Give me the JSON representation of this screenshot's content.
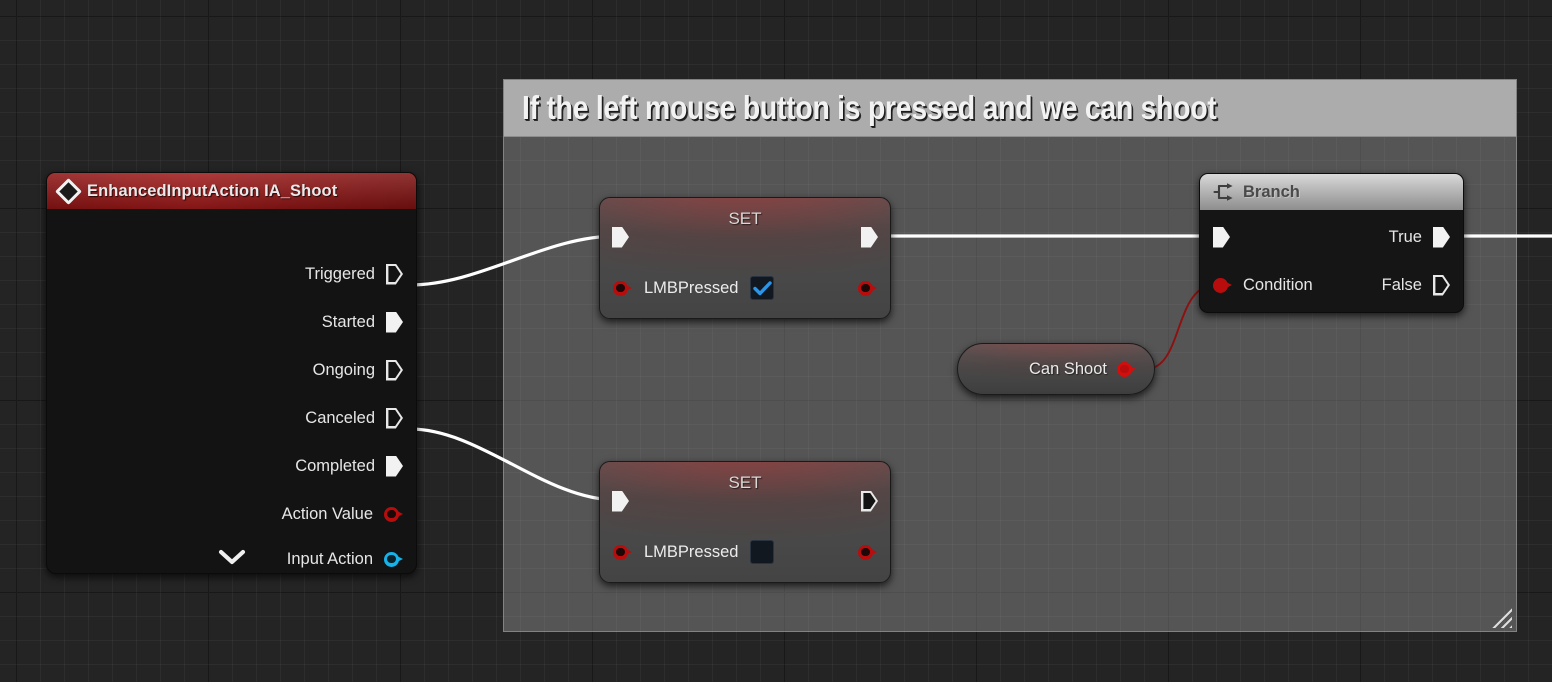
{
  "graph": {
    "background_color": "#242424",
    "grid_minor_color": "#2e2e2e",
    "grid_major_color": "#141414"
  },
  "comment": {
    "title": "If the left mouse button is pressed and we can shoot",
    "header_color": "#acacac",
    "body_color": "rgba(155,155,155,0.42)",
    "resize_handle": "resize-grip-icon"
  },
  "nodes": {
    "input_action": {
      "title": "EnhancedInputAction IA_Shoot",
      "icon": "diamond-icon",
      "header_color": "#a01a1a",
      "pins": [
        {
          "label": "Triggered",
          "type": "exec",
          "connected": false
        },
        {
          "label": "Started",
          "type": "exec",
          "connected": true
        },
        {
          "label": "Ongoing",
          "type": "exec",
          "connected": false
        },
        {
          "label": "Canceled",
          "type": "exec",
          "connected": false
        },
        {
          "label": "Completed",
          "type": "exec",
          "connected": true
        },
        {
          "label": "Action Value",
          "type": "struct",
          "color": "#b90d0d",
          "connected": false
        },
        {
          "label": "Input Action",
          "type": "object",
          "color": "#17b2e8",
          "connected": false
        }
      ],
      "collapse_icon": "chevron-down-icon"
    },
    "set_true": {
      "title": "SET",
      "variable": "LMBPressed",
      "value": true,
      "checkbox_checked": true,
      "check_color": "#2b96e8",
      "exec_in_connected": true,
      "exec_out_connected": true,
      "pin_color": "#b90d0d"
    },
    "set_false": {
      "title": "SET",
      "variable": "LMBPressed",
      "value": false,
      "checkbox_checked": false,
      "exec_in_connected": true,
      "exec_out_connected": false,
      "pin_color": "#b90d0d"
    },
    "branch": {
      "title": "Branch",
      "icon": "branch-icon",
      "header_color": "#b4b4b4",
      "exec_in_connected": true,
      "condition_label": "Condition",
      "condition_connected": true,
      "condition_color": "#d40d0d",
      "outputs": [
        {
          "label": "True",
          "connected": true
        },
        {
          "label": "False",
          "connected": false
        }
      ]
    },
    "can_shoot": {
      "label": "Can Shoot",
      "pin_color": "#d40d0d",
      "connected": true
    }
  },
  "wires": [
    {
      "from": "input_action.Started",
      "to": "set_true.exec_in",
      "color": "#ffffff",
      "width": 3.2
    },
    {
      "from": "input_action.Completed",
      "to": "set_false.exec_in",
      "color": "#ffffff",
      "width": 3.2
    },
    {
      "from": "set_true.exec_out",
      "to": "branch.exec_in",
      "color": "#ffffff",
      "width": 3.2
    },
    {
      "from": "can_shoot.output",
      "to": "branch.condition",
      "color": "#8e1010",
      "width": 1.8
    },
    {
      "from": "branch.True",
      "to": "offscreen-right",
      "color": "#ffffff",
      "width": 3.2
    }
  ]
}
